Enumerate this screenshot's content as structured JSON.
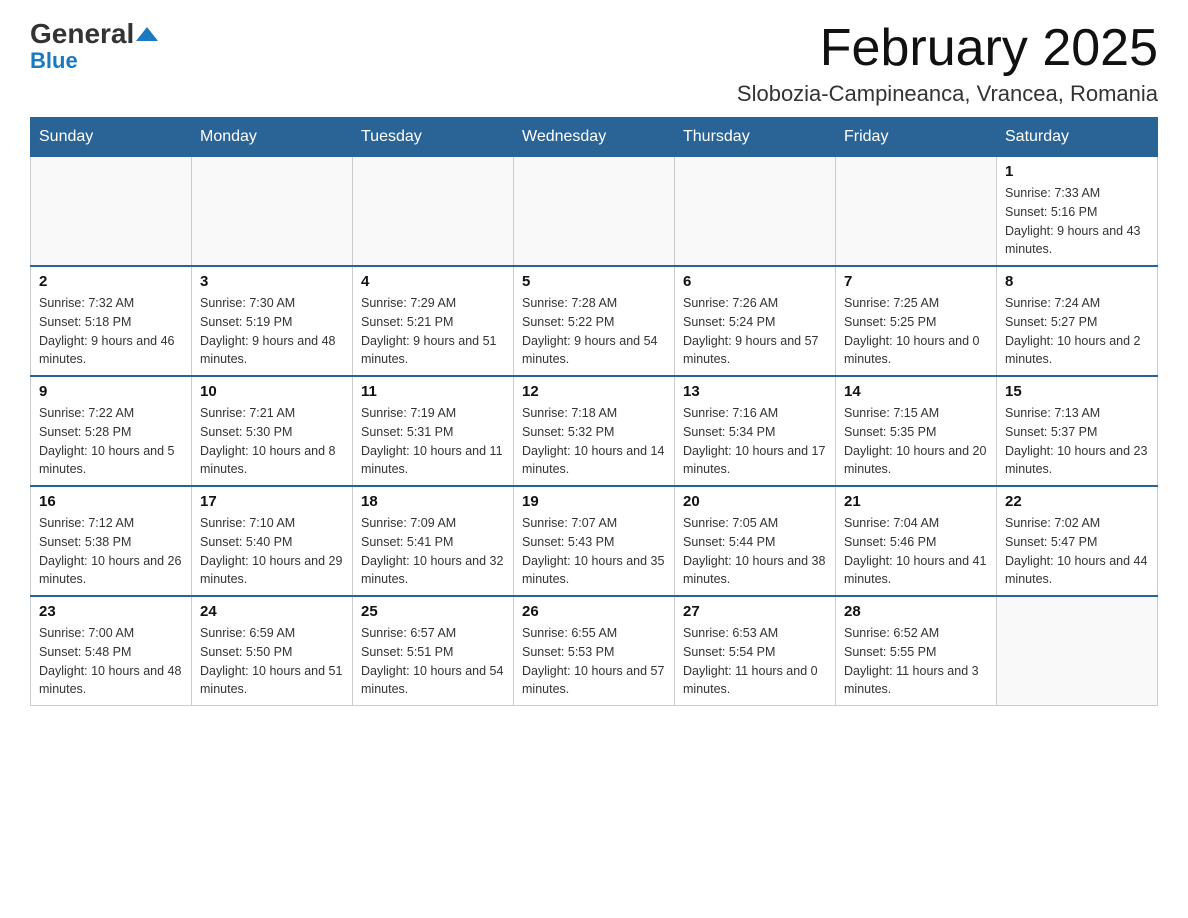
{
  "logo": {
    "text_general": "General",
    "text_blue": "Blue",
    "triangle": "▼"
  },
  "title": "February 2025",
  "location": "Slobozia-Campineanca, Vrancea, Romania",
  "days_of_week": [
    "Sunday",
    "Monday",
    "Tuesday",
    "Wednesday",
    "Thursday",
    "Friday",
    "Saturday"
  ],
  "weeks": [
    [
      {
        "day": "",
        "info": ""
      },
      {
        "day": "",
        "info": ""
      },
      {
        "day": "",
        "info": ""
      },
      {
        "day": "",
        "info": ""
      },
      {
        "day": "",
        "info": ""
      },
      {
        "day": "",
        "info": ""
      },
      {
        "day": "1",
        "info": "Sunrise: 7:33 AM\nSunset: 5:16 PM\nDaylight: 9 hours and 43 minutes."
      }
    ],
    [
      {
        "day": "2",
        "info": "Sunrise: 7:32 AM\nSunset: 5:18 PM\nDaylight: 9 hours and 46 minutes."
      },
      {
        "day": "3",
        "info": "Sunrise: 7:30 AM\nSunset: 5:19 PM\nDaylight: 9 hours and 48 minutes."
      },
      {
        "day": "4",
        "info": "Sunrise: 7:29 AM\nSunset: 5:21 PM\nDaylight: 9 hours and 51 minutes."
      },
      {
        "day": "5",
        "info": "Sunrise: 7:28 AM\nSunset: 5:22 PM\nDaylight: 9 hours and 54 minutes."
      },
      {
        "day": "6",
        "info": "Sunrise: 7:26 AM\nSunset: 5:24 PM\nDaylight: 9 hours and 57 minutes."
      },
      {
        "day": "7",
        "info": "Sunrise: 7:25 AM\nSunset: 5:25 PM\nDaylight: 10 hours and 0 minutes."
      },
      {
        "day": "8",
        "info": "Sunrise: 7:24 AM\nSunset: 5:27 PM\nDaylight: 10 hours and 2 minutes."
      }
    ],
    [
      {
        "day": "9",
        "info": "Sunrise: 7:22 AM\nSunset: 5:28 PM\nDaylight: 10 hours and 5 minutes."
      },
      {
        "day": "10",
        "info": "Sunrise: 7:21 AM\nSunset: 5:30 PM\nDaylight: 10 hours and 8 minutes."
      },
      {
        "day": "11",
        "info": "Sunrise: 7:19 AM\nSunset: 5:31 PM\nDaylight: 10 hours and 11 minutes."
      },
      {
        "day": "12",
        "info": "Sunrise: 7:18 AM\nSunset: 5:32 PM\nDaylight: 10 hours and 14 minutes."
      },
      {
        "day": "13",
        "info": "Sunrise: 7:16 AM\nSunset: 5:34 PM\nDaylight: 10 hours and 17 minutes."
      },
      {
        "day": "14",
        "info": "Sunrise: 7:15 AM\nSunset: 5:35 PM\nDaylight: 10 hours and 20 minutes."
      },
      {
        "day": "15",
        "info": "Sunrise: 7:13 AM\nSunset: 5:37 PM\nDaylight: 10 hours and 23 minutes."
      }
    ],
    [
      {
        "day": "16",
        "info": "Sunrise: 7:12 AM\nSunset: 5:38 PM\nDaylight: 10 hours and 26 minutes."
      },
      {
        "day": "17",
        "info": "Sunrise: 7:10 AM\nSunset: 5:40 PM\nDaylight: 10 hours and 29 minutes."
      },
      {
        "day": "18",
        "info": "Sunrise: 7:09 AM\nSunset: 5:41 PM\nDaylight: 10 hours and 32 minutes."
      },
      {
        "day": "19",
        "info": "Sunrise: 7:07 AM\nSunset: 5:43 PM\nDaylight: 10 hours and 35 minutes."
      },
      {
        "day": "20",
        "info": "Sunrise: 7:05 AM\nSunset: 5:44 PM\nDaylight: 10 hours and 38 minutes."
      },
      {
        "day": "21",
        "info": "Sunrise: 7:04 AM\nSunset: 5:46 PM\nDaylight: 10 hours and 41 minutes."
      },
      {
        "day": "22",
        "info": "Sunrise: 7:02 AM\nSunset: 5:47 PM\nDaylight: 10 hours and 44 minutes."
      }
    ],
    [
      {
        "day": "23",
        "info": "Sunrise: 7:00 AM\nSunset: 5:48 PM\nDaylight: 10 hours and 48 minutes."
      },
      {
        "day": "24",
        "info": "Sunrise: 6:59 AM\nSunset: 5:50 PM\nDaylight: 10 hours and 51 minutes."
      },
      {
        "day": "25",
        "info": "Sunrise: 6:57 AM\nSunset: 5:51 PM\nDaylight: 10 hours and 54 minutes."
      },
      {
        "day": "26",
        "info": "Sunrise: 6:55 AM\nSunset: 5:53 PM\nDaylight: 10 hours and 57 minutes."
      },
      {
        "day": "27",
        "info": "Sunrise: 6:53 AM\nSunset: 5:54 PM\nDaylight: 11 hours and 0 minutes."
      },
      {
        "day": "28",
        "info": "Sunrise: 6:52 AM\nSunset: 5:55 PM\nDaylight: 11 hours and 3 minutes."
      },
      {
        "day": "",
        "info": ""
      }
    ]
  ]
}
